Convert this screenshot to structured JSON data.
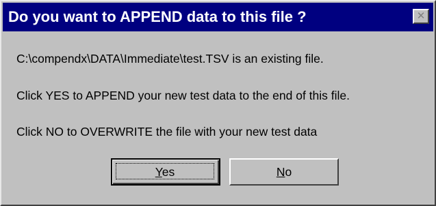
{
  "window": {
    "title": "Do you want to APPEND data to this file ?",
    "close_glyph": "✕",
    "close_icon": "close-icon",
    "titlebar_color": "#000080",
    "face_color": "#c0c0c0"
  },
  "message": {
    "line1": "C:\\compendx\\DATA\\Immediate\\test.TSV is an existing file.",
    "line2": "Click YES to APPEND your new test data to the end of this file.",
    "line3": "Click NO to OVERWRITE the file with your new test data"
  },
  "buttons": {
    "yes": {
      "mnemonic": "Y",
      "rest": "es"
    },
    "no": {
      "mnemonic": "N",
      "rest": "o"
    }
  }
}
